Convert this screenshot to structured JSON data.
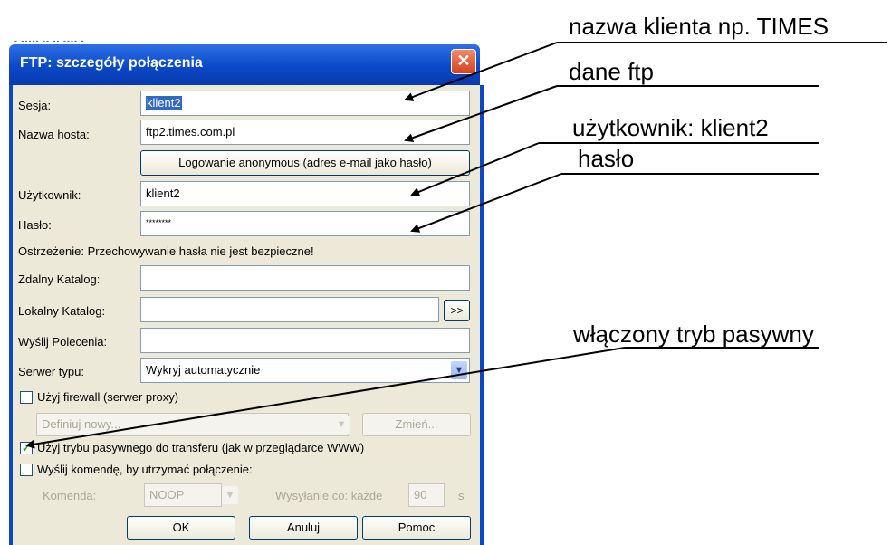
{
  "window": {
    "title": "FTP: szczegóły połączenia",
    "close_label": "✕",
    "top_fragment": "- ----- -- -- ---- -"
  },
  "form": {
    "session_label": "Sesja:",
    "session_value": "klient2",
    "host_label": "Nazwa hosta:",
    "host_value": "ftp2.times.com.pl",
    "anonymous_button": "Logowanie anonymous (adres e-mail jako hasło)",
    "user_label": "Użytkownik:",
    "user_value": "klient2",
    "password_label": "Hasło:",
    "password_value": "********",
    "warning": "Ostrzeżenie: Przechowywanie hasła nie jest bezpieczne!",
    "remote_dir_label": "Zdalny Katalog:",
    "remote_dir_value": "",
    "local_dir_label": "Lokalny Katalog:",
    "local_dir_value": "",
    "browse_button": ">>",
    "send_commands_label": "Wyślij Polecenia:",
    "send_commands_value": "",
    "server_type_label": "Serwer typu:",
    "server_type_value": "Wykryj automatycznie",
    "firewall_checkbox": "Użyj firewall (serwer proxy)",
    "firewall_checked": false,
    "firewall_select": "Definiuj nowy...",
    "change_button": "Zmień...",
    "passive_checkbox": "Użyj trybu pasywnego do transferu (jak w przeglądarce WWW)",
    "passive_checked": true,
    "keepalive_checkbox": "Wyślij komendę, by utrzymać połączenie:",
    "keepalive_checked": false,
    "command_label": "Komenda:",
    "command_value": "NOOP",
    "interval_label": "Wysyłanie co: każde",
    "interval_value": "90",
    "interval_unit": "s"
  },
  "buttons": {
    "ok": "OK",
    "cancel": "Anuluj",
    "help": "Pomoc"
  },
  "annotations": {
    "client_name": "nazwa klienta np. TIMES",
    "ftp_data": "dane ftp",
    "user": "użytkownik: klient2",
    "password": "hasło",
    "passive": "włączony tryb pasywny"
  },
  "colors": {
    "title_bar": "#0a48c6",
    "dialog_bg": "#ece9d8",
    "selection": "#316ac5",
    "close_button": "#d6411d"
  }
}
